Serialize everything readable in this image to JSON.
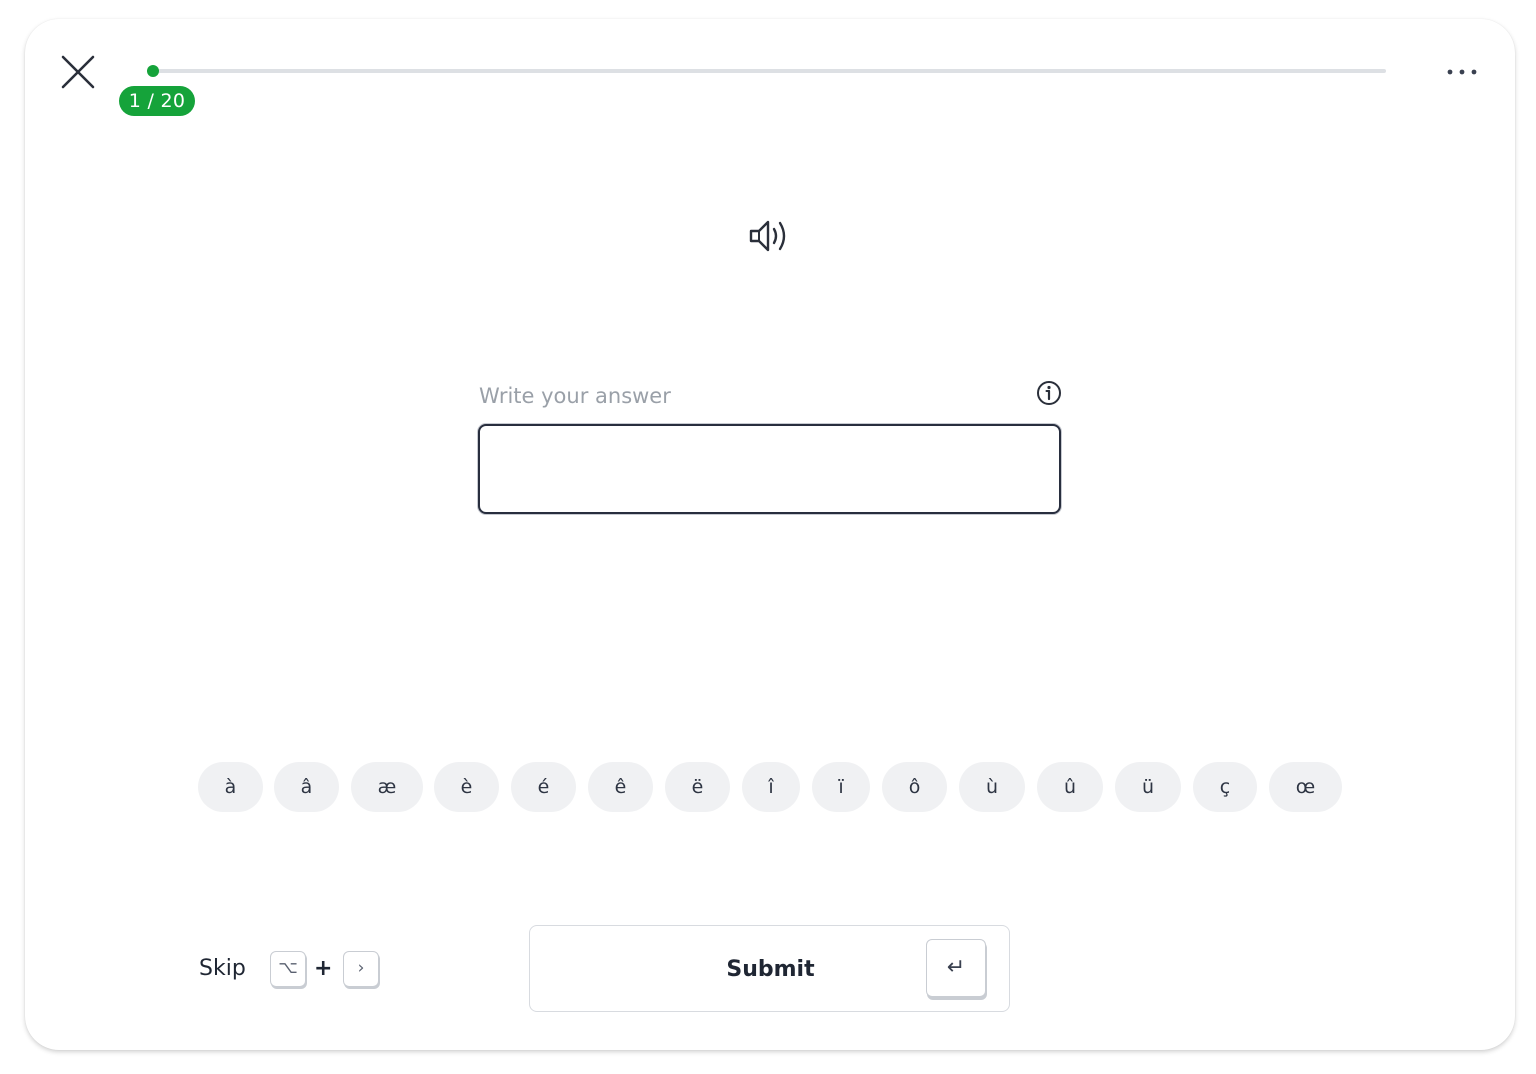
{
  "progress": {
    "current": 1,
    "total": 20,
    "badge_label": "1 / 20",
    "fraction": 0.0,
    "accent_color": "#15a33a"
  },
  "header": {
    "close_icon": "close-icon",
    "more_icon": "more-horizontal-icon"
  },
  "prompt": {
    "audio_icon": "speaker-icon"
  },
  "answer": {
    "label": "Write your answer",
    "value": "",
    "info_icon": "info-icon"
  },
  "special_characters": [
    "à",
    "â",
    "æ",
    "è",
    "é",
    "ê",
    "ë",
    "î",
    "ï",
    "ô",
    "ù",
    "û",
    "ü",
    "ç",
    "œ"
  ],
  "footer": {
    "skip_label": "Skip",
    "skip_shortcut": {
      "modifier": "⌥",
      "plus": "+",
      "key": "›"
    },
    "submit_label": "Submit",
    "submit_shortcut": "↵"
  }
}
